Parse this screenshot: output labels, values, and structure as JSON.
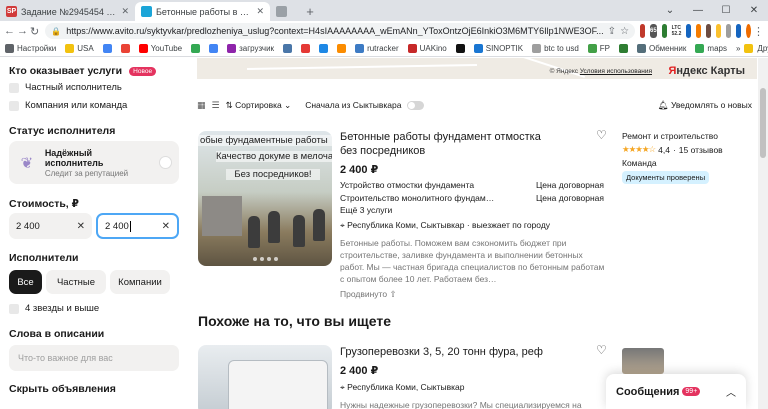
{
  "browser": {
    "tabs": [
      {
        "title": "Задание №2945454 - просмотр з",
        "fav": "SP",
        "color": "#d13b3b",
        "active": false
      },
      {
        "title": "Бетонные работы в Сыктывкаре",
        "fav": "A",
        "color": "#1ba5d8",
        "active": true
      },
      {
        "title": "",
        "fav": "",
        "color": "#9aa0a6",
        "active": false
      }
    ],
    "url": "https://www.avito.ru/syktyvkar/predlozheniya_uslug?context=H4sIAAAAAAAA_wEmANn_YToxOntzOjE6InkiO3M6MTY6Ilp1NWE3OF...",
    "bookmarks": [
      "Настройки",
      "USA",
      "",
      "",
      "YouTube",
      "",
      "",
      "загрузчик",
      "",
      "",
      "",
      "",
      "rutracker",
      "UAKino",
      "",
      "SINOPTIK",
      "btc to usd",
      "FP",
      "",
      "Обменник",
      "maps"
    ],
    "other_bookmarks": "Другие закладки",
    "ext_badges": [
      "65",
      "LTC 52.2"
    ]
  },
  "sidebar": {
    "provider_title": "Кто оказывает услуги",
    "new_badge": "Новое",
    "private_label": "Частный исполнитель",
    "company_label": "Компания или команда",
    "status_title": "Статус исполнителя",
    "reliable_title": "Надёжный исполнитель",
    "reliable_sub": "Следит за репутацией",
    "cost_title": "Стоимость, ₽",
    "price_from": "2 400",
    "price_to": "2 400",
    "performers_title": "Исполнители",
    "seg_all": "Все",
    "seg_private": "Частные",
    "seg_companies": "Компании",
    "rating_label": "4 звезды и выше",
    "words_title": "Слова в описании",
    "words_placeholder": "Что-то важное для вас",
    "hide_title": "Скрыть объявления"
  },
  "map": {
    "copyright": "© Яндекс",
    "terms": "Условия использования",
    "brand_red": "Я",
    "brand": "ндекс Карты"
  },
  "filterbar": {
    "sort": "Сортировка",
    "near_first": "Сначала из Сыктывкара",
    "notify": "Уведомлять о новых"
  },
  "listing1": {
    "image_line1": "обые фундаментные работы",
    "image_line2": "Качество докуме в мелоча",
    "image_line3": "Без посредников!",
    "title": "Бетонные работы фундамент отмостка без посредников",
    "price": "2 400 ₽",
    "services": [
      {
        "name": "Устройство отмостки фундамента",
        "price": "Цена договорная"
      },
      {
        "name": "Строительство монолитного фундам…",
        "price": "Цена договорная"
      }
    ],
    "more_services": "Ещё 3 услуги",
    "location": "Республика Коми, Сыктывкар · выезжает по городу",
    "description": "Бетонные работы. Поможем вам сэкономить бюджет при строительстве, заливке фундамента и выполнении бетонных работ. Мы — частная бригада специалистов по бетонным работам с опытом более 10 лет. Работаем без…",
    "promoted": "Продвинуто"
  },
  "seller1": {
    "category": "Ремонт и строительство",
    "rating": "4,4",
    "reviews": "15 отзывов",
    "role": "Команда",
    "verified": "Документы проверены"
  },
  "similar_title": "Похоже на то, что вы ищете",
  "listing2": {
    "title": "Грузоперевозки 3, 5, 20 тонн фура, реф",
    "price": "2 400 ₽",
    "location": "Республика Коми, Сыктывкар",
    "description": "Нужны надежные грузоперевозки? Мы специализируемся на"
  },
  "messages": {
    "label": "Сообщения",
    "count": "99+"
  }
}
